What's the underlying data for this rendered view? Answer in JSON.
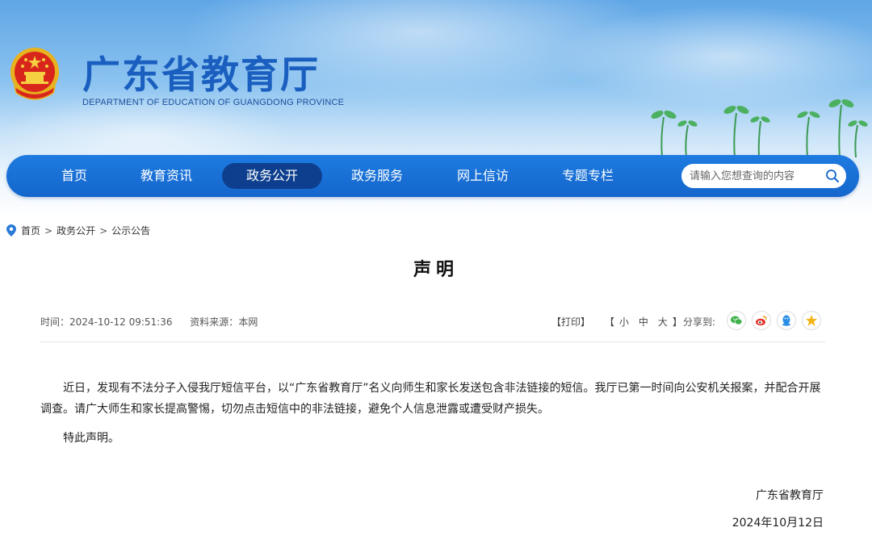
{
  "header": {
    "title": "广东省教育厅",
    "subtitle": "DEPARTMENT OF EDUCATION OF GUANGDONG PROVINCE",
    "emblem_icon": "national-emblem-icon"
  },
  "nav": {
    "items": [
      {
        "label": "首页",
        "active": false
      },
      {
        "label": "教育资讯",
        "active": false
      },
      {
        "label": "政务公开",
        "active": true
      },
      {
        "label": "政务服务",
        "active": false
      },
      {
        "label": "网上信访",
        "active": false
      },
      {
        "label": "专题专栏",
        "active": false
      }
    ],
    "search_placeholder": "请输入您想查询的内容"
  },
  "breadcrumb": [
    "首页",
    "政务公开",
    "公示公告"
  ],
  "article": {
    "title": "声明",
    "time_label": "时间：",
    "time": "2024-10-12 09:51:36",
    "source_label": "资料来源：",
    "source": "本网",
    "print": "【打印】",
    "size_open": "【",
    "size_small": "小",
    "size_medium": "中",
    "size_large": "大",
    "size_close": "】",
    "share_label": "分享到:",
    "share_icons": [
      "wechat-icon",
      "weibo-icon",
      "qq-icon",
      "qzone-icon"
    ],
    "paragraphs": [
      "近日，发现有不法分子入侵我厅短信平台，以“广东省教育厅”名义向师生和家长发送包含非法链接的短信。我厅已第一时间向公安机关报案，并配合开展调查。请广大师生和家长提高警惕，切勿点击短信中的非法链接，避免个人信息泄露或遭受财产损失。",
      "特此声明。"
    ],
    "signature": "广东省教育厅",
    "date": "2024年10月12日"
  },
  "colors": {
    "nav_bg": "#1670d6",
    "nav_active": "#0d3f8e",
    "title_blue": "#1a5fbf"
  }
}
